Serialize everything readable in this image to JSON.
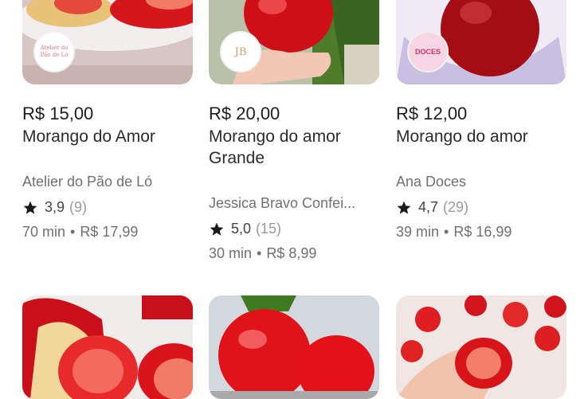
{
  "products": [
    {
      "price": "R$ 15,00",
      "title": "Morango do Amor",
      "store": "Atelier do Pão de Ló",
      "rating": "3,9",
      "reviews": "(9)",
      "time": "70 min",
      "fee": "R$ 17,99",
      "store_logo_text": "Atelier do Pão de Ló"
    },
    {
      "price": "R$ 20,00",
      "title": "Morango do amor Grande",
      "store": "Jessica Bravo Confei...",
      "rating": "5,0",
      "reviews": "(15)",
      "time": "30 min",
      "fee": "R$ 8,99",
      "store_logo_text": "JB"
    },
    {
      "price": "R$ 12,00",
      "title": "Morango do amor",
      "store": "Ana Doces",
      "rating": "4,7",
      "reviews": "(29)",
      "time": "39 min",
      "fee": "R$ 16,99",
      "store_logo_text": "DOCES"
    }
  ],
  "separator": "•",
  "colors": {
    "strawberry": "#e0161f",
    "text": "#1d1d1d",
    "muted": "#707070",
    "count": "#9a9a9a"
  }
}
